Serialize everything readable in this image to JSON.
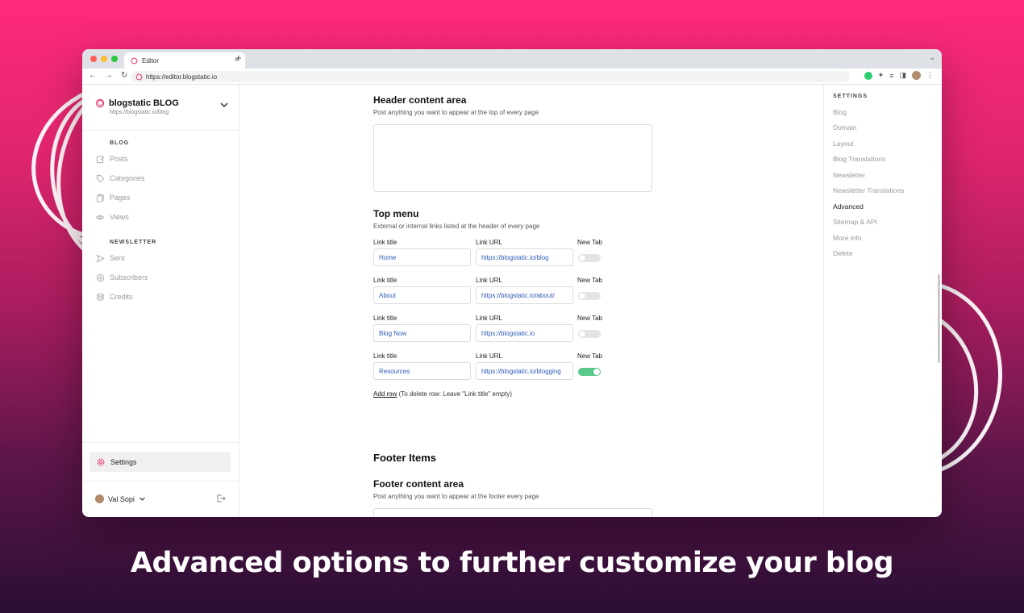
{
  "browser": {
    "tab_title": "Editor",
    "tab_close": "×",
    "new_tab": "+",
    "url": "https://editor.blogstatic.io"
  },
  "sidebar": {
    "brand_name": "blogstatic BLOG",
    "brand_url": "https://blogstatic.io/blog",
    "blog_section": "BLOG",
    "blog_items": [
      {
        "label": "Posts",
        "icon": "edit-icon"
      },
      {
        "label": "Categories",
        "icon": "tag-icon"
      },
      {
        "label": "Pages",
        "icon": "pages-icon"
      },
      {
        "label": "Views",
        "icon": "eye-icon"
      }
    ],
    "newsletter_section": "NEWSLETTER",
    "newsletter_items": [
      {
        "label": "Sent",
        "icon": "send-icon"
      },
      {
        "label": "Subscribers",
        "icon": "at-icon"
      },
      {
        "label": "Credits",
        "icon": "database-icon"
      }
    ],
    "settings_label": "Settings",
    "user_name": "Val Sopi"
  },
  "main": {
    "header_title": "Header content area",
    "header_desc": "Post anything you want to appear at the top of every page",
    "menu_title": "Top menu",
    "menu_desc": "External or internal links listed at the header of every page",
    "col_link_title": "Link title",
    "col_link_url": "Link URL",
    "col_new_tab": "New Tab",
    "menu_rows": [
      {
        "title": "Home",
        "url": "https://blogstatic.io/blog",
        "new_tab": false
      },
      {
        "title": "About",
        "url": "https://blogstatic.io/about/",
        "new_tab": false
      },
      {
        "title": "Blog Now",
        "url": "https://blogstatic.io",
        "new_tab": false
      },
      {
        "title": "Resources",
        "url": "https://blogstatic.io/blogging",
        "new_tab": true
      }
    ],
    "add_row": "Add row",
    "add_row_hint": " (To delete row: Leave \"Link title\" empty)",
    "footer_items_title": "Footer Items",
    "footer_title": "Footer content area",
    "footer_desc": "Post anything you want to appear at the footer every page"
  },
  "rightpanel": {
    "label": "SETTINGS",
    "items": [
      "Blog",
      "Domain",
      "Layout",
      "Blog Translations",
      "Newsletter",
      "Newsletter Translations",
      "Advanced",
      "Sitemap & API",
      "More info",
      "Delete"
    ],
    "active": "Advanced"
  },
  "caption": "Advanced options to further customize your blog",
  "colors": {
    "accent": "#e8437a",
    "toggle_on": "#58c98b",
    "link": "#2d5bb8"
  }
}
